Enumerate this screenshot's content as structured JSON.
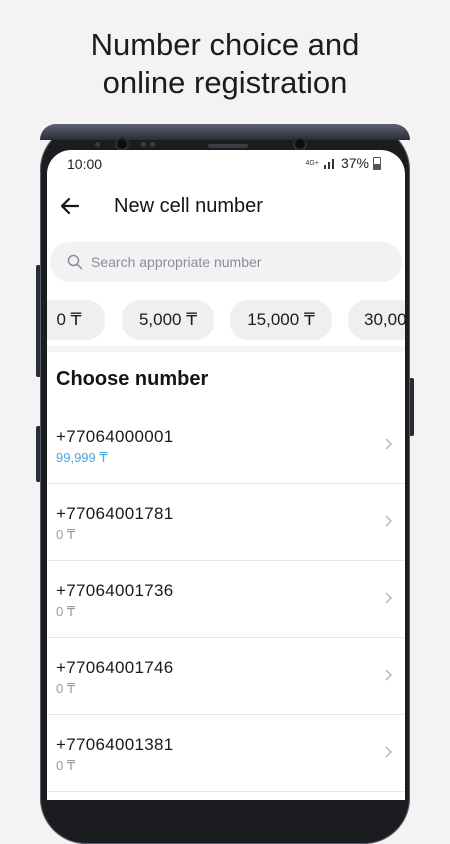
{
  "headline": {
    "line1": "Number choice and",
    "line2": "online registration"
  },
  "status_bar": {
    "time": "10:00",
    "network": "4G+",
    "battery": "37%"
  },
  "app_bar": {
    "title": "New cell number"
  },
  "search": {
    "placeholder": "Search appropriate number",
    "value": ""
  },
  "price_filters": [
    "0 ₸",
    "5,000 ₸",
    "15,000 ₸",
    "30,00"
  ],
  "section": {
    "title": "Choose number"
  },
  "numbers": [
    {
      "number": "+77064000001",
      "price": "99,999 ₸"
    },
    {
      "number": "+77064001781",
      "price": "0 ₸"
    },
    {
      "number": "+77064001736",
      "price": "0 ₸"
    },
    {
      "number": "+77064001746",
      "price": "0 ₸"
    },
    {
      "number": "+77064001381",
      "price": "0 ₸"
    }
  ],
  "colors": {
    "accent_price": "#4aa8da",
    "chip_bg": "#eeeff1",
    "background": "#f3f3f3"
  },
  "icons": {
    "back": "arrow-left-icon",
    "search": "search-icon",
    "row": "chevron-right-icon"
  }
}
